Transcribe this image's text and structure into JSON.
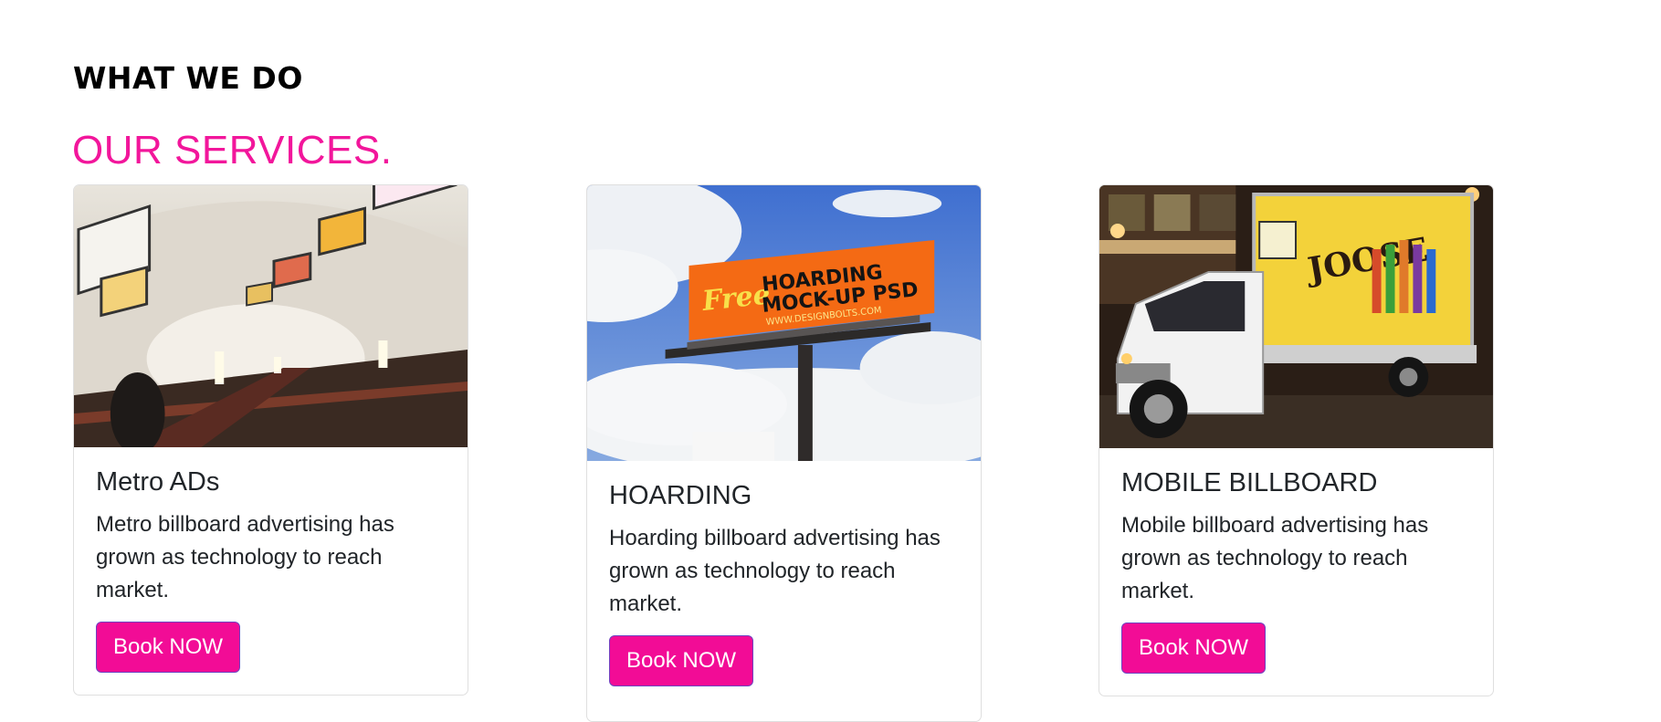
{
  "section": {
    "eyebrow": "WHAT WE DO",
    "headline": "OUR SERVICES.",
    "accent_color": "#f20c96"
  },
  "cards": [
    {
      "title": "Metro ADs",
      "text": "Metro billboard advertising has grown as technology to reach market.",
      "button": "Book NOW"
    },
    {
      "title": "HOARDING",
      "text": "Hoarding billboard advertising has grown as technology to reach market.",
      "button": "Book NOW",
      "image_text": {
        "line1": "HOARDING",
        "line2": "MOCK-UP PSD",
        "script": "Free",
        "url": "WWW.DESIGNBOLTS.COM"
      }
    },
    {
      "title": "MOBILE BILLBOARD",
      "text": "Mobile billboard advertising has grown as technology to reach market.",
      "button": "Book NOW",
      "image_text": {
        "brand": "JOOSE"
      }
    }
  ]
}
